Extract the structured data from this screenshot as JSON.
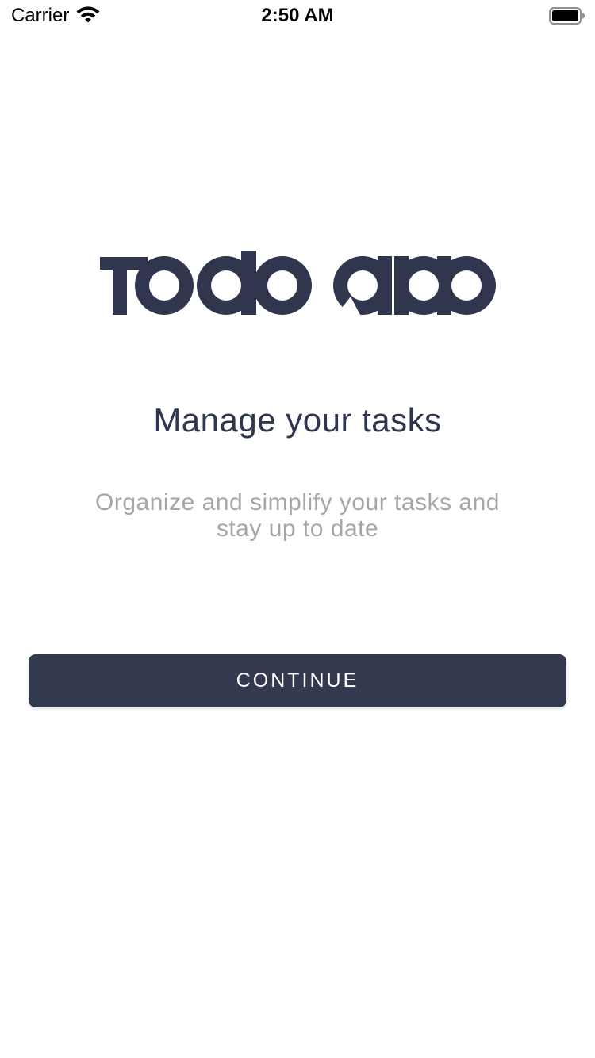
{
  "status_bar": {
    "carrier": "Carrier",
    "time": "2:50 AM",
    "wifi_icon": "wifi-icon",
    "battery_icon": "battery-full-icon"
  },
  "logo": {
    "text": "Todo app",
    "color": "#2f364d"
  },
  "onboarding": {
    "headline": "Manage your tasks",
    "subtitle_line1": "Organize and simplify your tasks and",
    "subtitle_line2": "stay up to date"
  },
  "actions": {
    "continue_label": "CONTINUE"
  },
  "colors": {
    "primary": "#333a50",
    "heading_text": "#2f364d",
    "muted_text": "#a6a6a6",
    "background": "#ffffff"
  }
}
